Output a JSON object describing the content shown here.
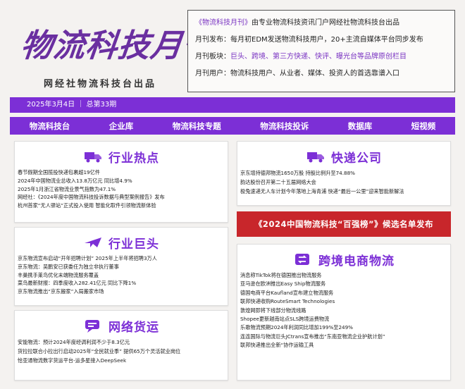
{
  "header": {
    "logo_text": "物流科技月刊",
    "logo_sub": "网经社物流科技台出品",
    "info": [
      {
        "key": "《物流科技月刊》",
        "text": "由专业物流科技资讯门户网经社物流科技台出品"
      },
      {
        "key": "月刊发布：",
        "text": "每月初EDM发送物流科技用户，20+主流自媒体平台同步发布"
      },
      {
        "key": "月刊板块：",
        "text": "巨头、跨境、第三方快递、快评、曝光台等品牌原创栏目"
      },
      {
        "key": "月刊用户：",
        "text": "物流科技用户、从业者、媒体、投资人的首选靠谱入口"
      }
    ]
  },
  "datebar": {
    "text": "2025年3月4日 ｜ 总第33期"
  },
  "nav": [
    "物流科技台",
    "企业库",
    "物流科技专题",
    "物流科技投诉",
    "数据库",
    "短视频"
  ],
  "cards": {
    "hot": {
      "title": "行业热点",
      "items": [
        "春节假期全国揽投快递包裹超19亿件",
        "2024年中国物流业总收入13.8万亿元 同比增4.9%",
        "2025年1月浙江省物流业景气指数为47.1%",
        "网经社：《2024年度中国物流科技投诉数据与典型案例报告》发布",
        "杭州首家“无人驿站”正式投入使用 智能化取件引领物流新体验"
      ]
    },
    "giants": {
      "title": "行业巨头",
      "items": [
        "京东物流宣布启动“开年招聘计划” 2025年上半年将招聘3万人",
        "京东物流：吴鹏安已获委任为独立非执行董事",
        "丰巢携手莱鸟优化末端物流服务覆盖",
        "菜鸟最新财报：四季度收入282.41亿元 同比下降1%",
        "京东物流推出“京东搬家”入局搬家市场"
      ]
    },
    "freight": {
      "title": "网络货运",
      "items": [
        "安能物流：预计2024年度经调利润不少于8.3亿元",
        "货拉拉联合小拉出行启动2025年“全民就业季” 提供65万个灵活就业岗位",
        "恰亚通物流数字货运平台-运多星接入DeepSeek"
      ]
    },
    "express": {
      "title": "快递公司",
      "items": [
        "京东增持德邦物流1650万股 持股比例升至74.88%",
        "韵达股份召开第二十五届网络大会",
        "极兔速递无人车计划今年落地上海青浦 快递“最后一公里”迎来智能新解法"
      ]
    },
    "cross": {
      "title": "跨境电商物流",
      "items": [
        "消息称TikTok将在德国推出物流服务",
        "亚马逊在欧洲推出Easy Ship物流服务",
        "德国电商平台Kaufland宣布建立物流服务",
        "联邦快递收购RouteSmart Technologies",
        "敦煌网即将下线部分物流线路",
        "Shopee更新越南站点SLS跨境运费物流",
        "乐歌物流预期2024年利润同比增加199%至249%",
        "连连国际与物流巨头JCtrans宣布推出“东南亚物流企业护航计划”",
        "联邦快递推出全新“协作运输工具"
      ]
    }
  },
  "banner": {
    "text": "《2024中国物流科技“百强榜”》候选名单发布"
  },
  "colors": {
    "accent": "#7c2fd6",
    "banner": "#c8262b",
    "logo": "#6a2fa0"
  },
  "icons": {
    "hot": "truck-icon",
    "giants": "plane-icon",
    "freight": "chat-bubble-icon",
    "express": "truck-icon",
    "cross": "shuffle-icon"
  }
}
